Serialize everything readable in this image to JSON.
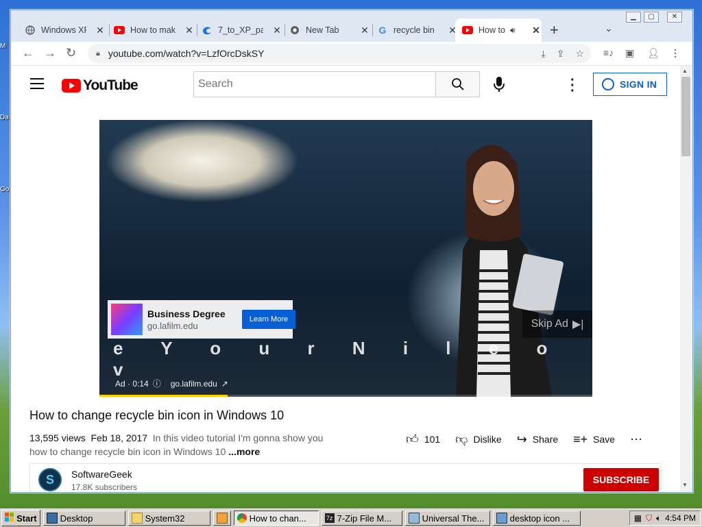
{
  "desktop": {
    "edge_labels": [
      "M",
      "Da",
      "Go"
    ]
  },
  "browser": {
    "tabs": [
      {
        "title": "Windows XP",
        "icon": "globe-icon"
      },
      {
        "title": "How to mak",
        "icon": "youtube-icon"
      },
      {
        "title": "7_to_XP_pa",
        "icon": "edge-icon"
      },
      {
        "title": "New Tab",
        "icon": "chrome-icon"
      },
      {
        "title": "recycle bin",
        "icon": "google-icon"
      },
      {
        "title": "How to",
        "icon": "youtube-icon",
        "active": true,
        "audio": true
      }
    ],
    "new_tab": "+",
    "url": "youtube.com/watch?v=LzfOrcDskSY"
  },
  "youtube": {
    "logo": "YouTube",
    "search_placeholder": "Search",
    "sign_in": "SIGN IN",
    "ad": {
      "title": "Business Degree",
      "domain": "go.lafilm.edu",
      "cta": "Learn More",
      "skip": "Skip Ad",
      "label": "Ad · 0:14",
      "link": "go.lafilm.edu",
      "overlay": "e Y o u r N i l e o v",
      "progress": 0.26
    },
    "video": {
      "title": "How to change recycle bin icon in Windows 10",
      "views": "13,595 views",
      "date": "Feb 18, 2017",
      "desc_line1": "In this video tutorial I'm gonna show you",
      "desc_line2": "how to change recycle bin icon in Windows 10",
      "more": "...more",
      "likes": "101",
      "dislike": "Dislike",
      "share": "Share",
      "save": "Save"
    },
    "channel": {
      "name": "SoftwareGeek",
      "subscribers": "17.8K subscribers",
      "subscribe": "SUBSCRIBE"
    }
  },
  "taskbar": {
    "start": "Start",
    "items": [
      {
        "label": "Desktop",
        "icon": "desktop-icon"
      },
      {
        "label": "System32",
        "icon": "folder-icon"
      },
      {
        "label": "",
        "icon": "media-icon"
      },
      {
        "label": "How to chan...",
        "icon": "chrome-icon",
        "active": true
      },
      {
        "label": "7-Zip File M...",
        "icon": "7zip-icon"
      },
      {
        "label": "Universal The...",
        "icon": "app-icon"
      },
      {
        "label": "desktop icon ...",
        "icon": "window-icon"
      }
    ],
    "clock": "4:54 PM"
  }
}
